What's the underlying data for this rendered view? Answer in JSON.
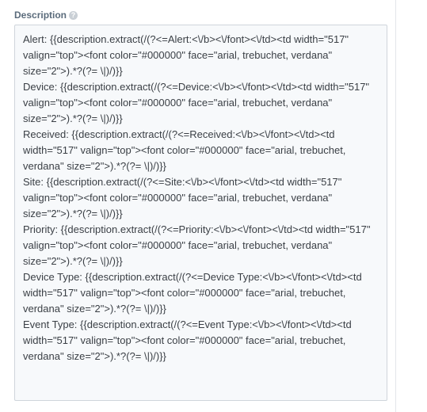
{
  "field": {
    "label": "Description",
    "help_icon_glyph": "?",
    "help_icon": "question-circle-icon",
    "value": "Alert: {{description.extract(/(?<=Alert:<\\/b><\\/font><\\/td><td width=\"517\" valign=\"top\"><font color=\"#000000\" face=\"arial, trebuchet, verdana\" size=\"2\">).*?(?= \\|)/)}}\nDevice: {{description.extract(/(?<=Device:<\\/b><\\/font><\\/td><td width=\"517\" valign=\"top\"><font color=\"#000000\" face=\"arial, trebuchet, verdana\" size=\"2\">).*?(?= \\|)/)}}\nReceived: {{description.extract(/(?<=Received:<\\/b><\\/font><\\/td><td width=\"517\" valign=\"top\"><font color=\"#000000\" face=\"arial, trebuchet, verdana\" size=\"2\">).*?(?= \\|)/)}}\nSite: {{description.extract(/(?<=Site:<\\/b><\\/font><\\/td><td width=\"517\" valign=\"top\"><font color=\"#000000\" face=\"arial, trebuchet, verdana\" size=\"2\">).*?(?= \\|)/)}}\nPriority: {{description.extract(/(?<=Priority:<\\/b><\\/font><\\/td><td width=\"517\" valign=\"top\"><font color=\"#000000\" face=\"arial, trebuchet, verdana\" size=\"2\">).*?(?= \\|)/)}}\nDevice Type: {{description.extract(/(?<=Device Type:<\\/b><\\/font><\\/td><td width=\"517\" valign=\"top\"><font color=\"#000000\" face=\"arial, trebuchet, verdana\" size=\"2\">).*?(?= \\|)/)}}\nEvent Type: {{description.extract(/(?<=Event Type:<\\/b><\\/font><\\/td><td width=\"517\" valign=\"top\"><font color=\"#000000\" face=\"arial, trebuchet, verdana\" size=\"2\">).*?(?= \\|)/)}}"
  },
  "colors": {
    "label": "#5a6b7b",
    "textarea_bg": "#f7f9fb",
    "textarea_border": "#cfd5db",
    "text": "#3a3f45"
  }
}
